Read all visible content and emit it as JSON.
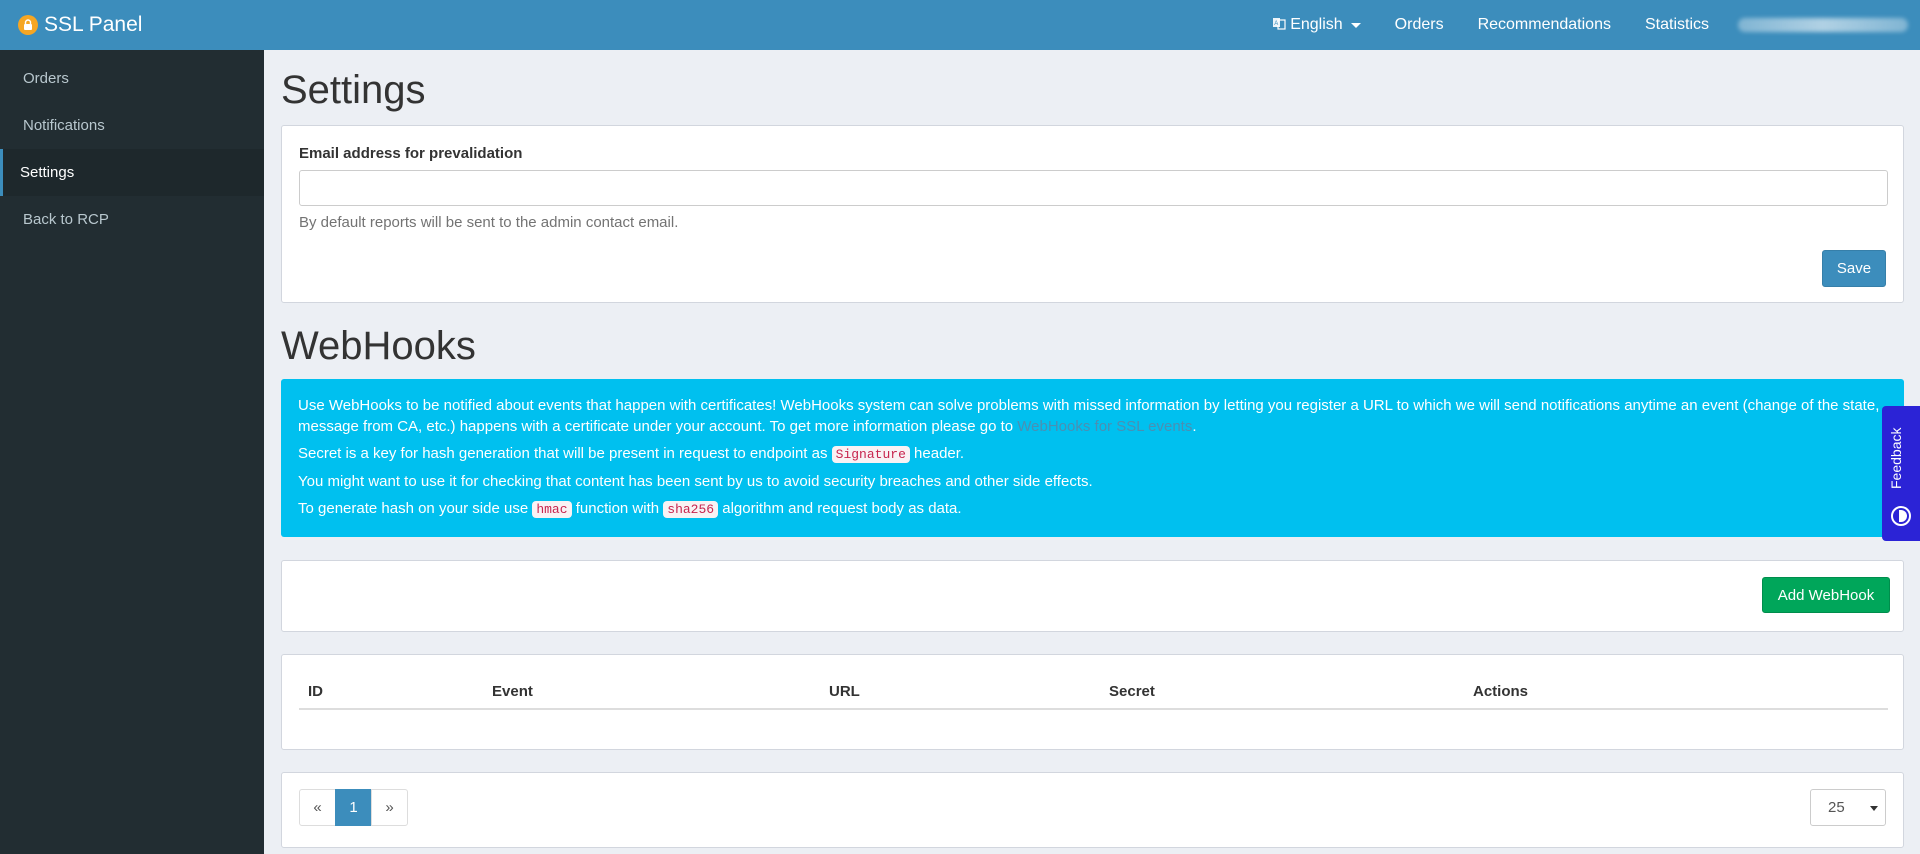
{
  "navbar": {
    "brand": "SSL Panel",
    "language": "English",
    "links": [
      "Orders",
      "Recommendations",
      "Statistics"
    ]
  },
  "sidebar": {
    "items": [
      {
        "label": "Orders"
      },
      {
        "label": "Notifications"
      },
      {
        "label": "Settings",
        "active": true
      },
      {
        "label": "Back to RCP"
      }
    ]
  },
  "settings": {
    "title": "Settings",
    "email_label": "Email address for prevalidation",
    "email_value": "",
    "help": "By default reports will be sent to the admin contact email.",
    "save_label": "Save"
  },
  "webhooks": {
    "title": "WebHooks",
    "info": {
      "p1_text": "Use WebHooks to be notified about events that happen with certificates! WebHooks system can solve problems with missed information by letting you register a URL to which we will send notifications anytime an event (change of the state, message from CA, etc.) happens with a certificate under your account. To get more information please go to ",
      "p1_link": "WebHooks for SSL events",
      "p1_end": ".",
      "p2_before": "Secret is a key for hash generation that will be present in request to endpoint as ",
      "p2_code": "Signature",
      "p2_after": " header.",
      "p3": "You might want to use it for checking that content has been sent by us to avoid security breaches and other side effects.",
      "p4_before": "To generate hash on your side use ",
      "p4_code1": "hmac",
      "p4_mid": " function with ",
      "p4_code2": "sha256",
      "p4_after": " algorithm and request body as data."
    },
    "add_label": "Add WebHook",
    "table": {
      "columns": [
        "ID",
        "Event",
        "URL",
        "Secret",
        "Actions"
      ],
      "rows": []
    },
    "pager": {
      "prev": "«",
      "current": "1",
      "next": "»",
      "page_size": "25"
    }
  },
  "feedback": {
    "label": "Feedback"
  },
  "colors": {
    "navbar": "#3c8dbc",
    "sidebar": "#222d32",
    "callout": "#00c0ef",
    "add_button": "#00a65a",
    "feedback": "#2b23d6"
  },
  "icons": {
    "brand": "lock-icon",
    "language": "language-icon",
    "feedback": "feedback-icon"
  }
}
